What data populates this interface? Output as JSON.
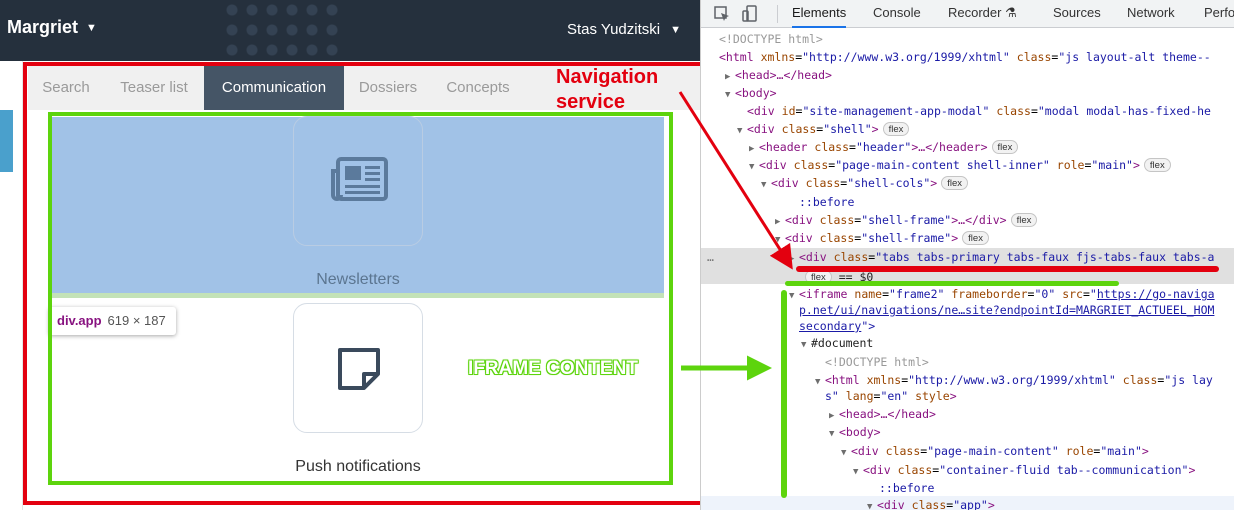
{
  "app": {
    "brand": "Margriet",
    "user": "Stas Yudzitski",
    "tabs": [
      "Search",
      "Teaser list",
      "Communication",
      "Dossiers",
      "Concepts"
    ],
    "active_tab": "Communication",
    "tiles": [
      {
        "label": "Newsletters",
        "icon": "newspaper-icon"
      },
      {
        "label": "Push notifications",
        "icon": "note-icon"
      }
    ],
    "tooltip": {
      "tag": "div.app",
      "size": "619 × 187"
    }
  },
  "annotations": {
    "navigation_line1": "Navigation",
    "navigation_line2": "service",
    "iframe_content": "IFRAME CONTENT",
    "colors": {
      "red": "#e3000f",
      "green": "#5dd40d",
      "highlight": "#7daade"
    }
  },
  "devtools": {
    "tabs": [
      "Elements",
      "Console",
      "Recorder",
      "Sources",
      "Network",
      "Perfo"
    ],
    "active_tab": "Elements",
    "recorder_icon": "flask-icon",
    "tree": {
      "doctype": "<!DOCTYPE html>",
      "html_open": "<html",
      "html_attr_xmlns": "xmlns",
      "html_attr_xmlns_val": "\"http://www.w3.org/1999/xhtml\"",
      "html_attr_class": "class",
      "html_attr_class_val": "\"js layout-alt theme--",
      "head": "<head>…</head>",
      "body": "<body>",
      "modal_open": "<div",
      "modal_id_attr": "id",
      "modal_id_val": "\"site-management-app-modal\"",
      "modal_class_attr": "class",
      "modal_class_val": "\"modal modal-has-fixed-he",
      "shell_open": "<div",
      "shell_class_attr": "class",
      "shell_class_val": "\"shell\"",
      "shell_close": ">",
      "header_open": "<header",
      "header_class_attr": "class",
      "header_class_val": "\"header\"",
      "header_close": ">…</header>",
      "main_open": "<div",
      "main_class_attr": "class",
      "main_class_val": "\"page-main-content shell-inner\"",
      "main_role_attr": "role",
      "main_role_val": "\"main\"",
      "main_close": ">",
      "cols_open": "<div",
      "cols_class_attr": "class",
      "cols_class_val": "\"shell-cols\"",
      "cols_close": ">",
      "before": "::before",
      "frame1_open": "<div",
      "frame1_class_attr": "class",
      "frame1_class_val": "\"shell-frame\"",
      "frame1_close": ">…</div>",
      "frame2_open": "<div",
      "frame2_class_attr": "class",
      "frame2_class_val": "\"shell-frame\"",
      "frame2_close": ">",
      "tabs_open": "<div",
      "tabs_class_attr": "class",
      "tabs_class_val": "\"tabs tabs-primary tabs-faux fjs-tabs-faux tabs-a",
      "tabs_sub": "== $0",
      "iframe_open": "<iframe",
      "iframe_name_attr": "name",
      "iframe_name_val": "\"frame2\"",
      "iframe_fb_attr": "frameborder",
      "iframe_fb_val": "\"0\"",
      "iframe_src_attr": "src",
      "iframe_src_val_1": "https://go-naviga",
      "iframe_src_val_2": "p.net/ui/navigations/ne…site?endpointId=MARGRIET_ACTUEEL_HOM",
      "iframe_src_val_3": "secondary",
      "iframe_close": "\">",
      "document": "#document",
      "doctype2": "<!DOCTYPE html>",
      "html2_open": "<html",
      "html2_xmlns_attr": "xmlns",
      "html2_xmlns_val": "\"http://www.w3.org/1999/xhtml\"",
      "html2_class_attr": "class",
      "html2_class_val": "\"js lay",
      "html2_cont_1": "s\"",
      "html2_lang_attr": "lang",
      "html2_lang_val": "\"en\"",
      "html2_style_attr": "style",
      "html2_close": ">",
      "head2": "<head>…</head>",
      "body2": "<body>",
      "main2_open": "<div",
      "main2_class_attr": "class",
      "main2_class_val": "\"page-main-content\"",
      "main2_role_attr": "role",
      "main2_role_val": "\"main\"",
      "main2_close": ">",
      "fluid_open": "<div",
      "fluid_class_attr": "class",
      "fluid_class_val": "\"container-fluid tab--communication\"",
      "fluid_close": ">",
      "before2": "::before",
      "app_open": "<div",
      "app_class_attr": "class",
      "app_class_val": "\"app\"",
      "app_close": ">",
      "flex": "flex"
    }
  }
}
